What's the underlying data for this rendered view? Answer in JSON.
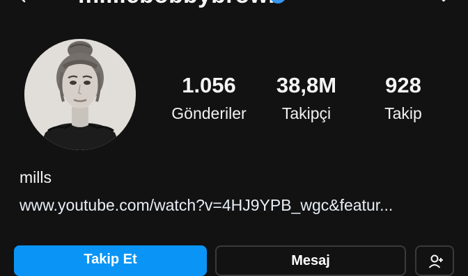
{
  "header": {
    "username": "milliebobbybrown",
    "back_icon": "back-arrow-icon",
    "verified_icon": "verified-badge-icon",
    "menu_icon": "chevron-down-icon",
    "verified_color": "#3897f0"
  },
  "profile": {
    "avatar": "profile-photo"
  },
  "stats": [
    {
      "value": "1.056",
      "label": "Gönderiler"
    },
    {
      "value": "38,8M",
      "label": "Takipçi"
    },
    {
      "value": "928",
      "label": "Takip"
    }
  ],
  "bio": {
    "name": "mills",
    "link": "www.youtube.com/watch?v=4HJ9YPB_wgc&featur..."
  },
  "actions": {
    "follow_label": "Takip Et",
    "message_label": "Mesaj",
    "suggest_icon": "person-add-icon",
    "follow_color": "#0a95f6"
  }
}
